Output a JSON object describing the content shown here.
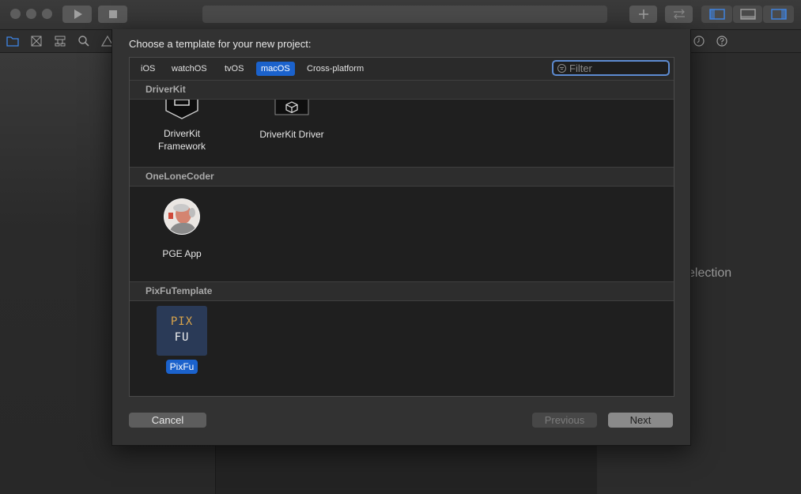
{
  "sheet": {
    "title": "Choose a template for your new project:",
    "filter_placeholder": "Filter",
    "tabs": [
      {
        "label": "iOS"
      },
      {
        "label": "watchOS"
      },
      {
        "label": "tvOS"
      },
      {
        "label": "macOS",
        "selected": true
      },
      {
        "label": "Cross-platform"
      }
    ],
    "sections": [
      {
        "title": "DriverKit",
        "templates": [
          {
            "label": "DriverKit\nFramework"
          },
          {
            "label": "DriverKit Driver"
          }
        ]
      },
      {
        "title": "OneLoneCoder",
        "templates": [
          {
            "label": "PGE App"
          }
        ]
      },
      {
        "title": "PixFuTemplate",
        "templates": [
          {
            "label": "PixFu",
            "selected": true,
            "icon_text_top": "PIX",
            "icon_text_bottom": "FU"
          }
        ]
      }
    ],
    "buttons": {
      "cancel": "Cancel",
      "previous": "Previous",
      "next": "Next"
    }
  },
  "inspector": {
    "placeholder": "election"
  },
  "colors": {
    "accent": "#1b62cc",
    "background": "#2b2b2b",
    "sheet": "#323232",
    "pix_gold": "#d9a44a"
  }
}
